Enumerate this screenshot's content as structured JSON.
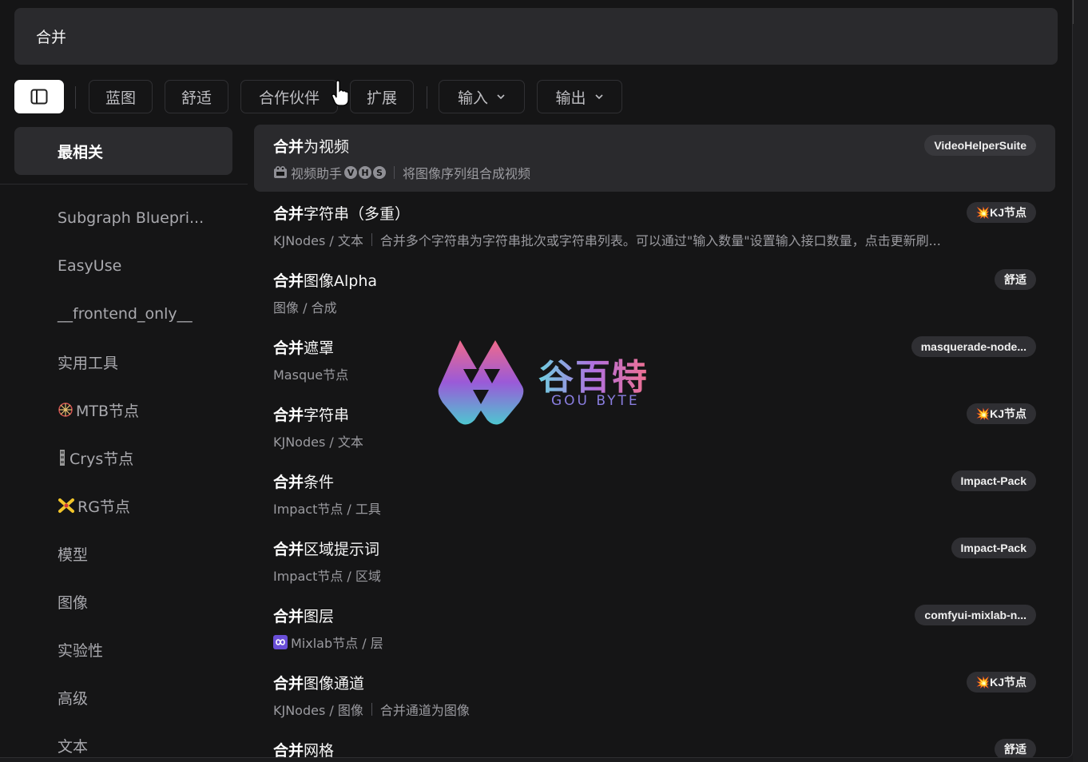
{
  "search": {
    "value": "合并"
  },
  "filters": {
    "chips": [
      "蓝图",
      "舒适",
      "合作伙伴",
      "扩展"
    ],
    "dropdowns": [
      "输入",
      "输出"
    ]
  },
  "sidebar": {
    "active": "最相关",
    "items": [
      {
        "label": "Subgraph Bluepri...",
        "icon": ""
      },
      {
        "label": "EasyUse",
        "icon": ""
      },
      {
        "label": "__frontend_only__",
        "icon": ""
      },
      {
        "label": "实用工具",
        "icon": ""
      },
      {
        "label": "MTB节点",
        "icon": "sparkle-icon"
      },
      {
        "label": "Crys节点",
        "icon": "bar-icon"
      },
      {
        "label": "RG节点",
        "icon": "cross-star-icon"
      },
      {
        "label": "模型",
        "icon": ""
      },
      {
        "label": "图像",
        "icon": ""
      },
      {
        "label": "实验性",
        "icon": ""
      },
      {
        "label": "高级",
        "icon": ""
      },
      {
        "label": "文本",
        "icon": ""
      }
    ]
  },
  "results": [
    {
      "bold": "合并",
      "rest": "为视频",
      "category": "视频助手",
      "desc": "将图像序列组合成视频",
      "badge": "VideoHelperSuite",
      "icon": "camera-icon",
      "vhs": [
        "V",
        "H",
        "S"
      ]
    },
    {
      "bold": "合并",
      "rest": "字符串（多重）",
      "category": "KJNodes / 文本",
      "desc": "合并多个字符串为字符串批次或字符串列表。可以通过\"输入数量\"设置输入接口数量，点击更新刷...",
      "badge": "💥KJ节点"
    },
    {
      "bold": "合并",
      "rest": "图像Alpha",
      "category": "图像 / 合成",
      "desc": "",
      "badge": "舒适"
    },
    {
      "bold": "合并",
      "rest": "遮罩",
      "category": "Masque节点",
      "desc": "",
      "badge": "masquerade-node..."
    },
    {
      "bold": "合并",
      "rest": "字符串",
      "category": "KJNodes / 文本",
      "desc": "",
      "badge": "💥KJ节点"
    },
    {
      "bold": "合并",
      "rest": "条件",
      "category": "Impact节点 / 工具",
      "desc": "",
      "badge": "Impact-Pack"
    },
    {
      "bold": "合并",
      "rest": "区域提示词",
      "category": "Impact节点 / 区域",
      "desc": "",
      "badge": "Impact-Pack"
    },
    {
      "bold": "合并",
      "rest": "图层",
      "category": "Mixlab节点 / 层",
      "desc": "",
      "badge": "comfyui-mixlab-n...",
      "icon": "infinity-icon"
    },
    {
      "bold": "合并",
      "rest": "图像通道",
      "category": "KJNodes / 图像",
      "desc": "合并通道为图像",
      "badge": "💥KJ节点"
    },
    {
      "bold": "合并",
      "rest": "网格",
      "category": "",
      "desc": "",
      "badge": "舒适"
    }
  ],
  "watermark": {
    "title": "谷百特",
    "subtitle": "GOU BYTE"
  },
  "colors": {
    "panel": "#151516",
    "highlight": "#2a2a2d",
    "badge": "#2f2f33"
  }
}
